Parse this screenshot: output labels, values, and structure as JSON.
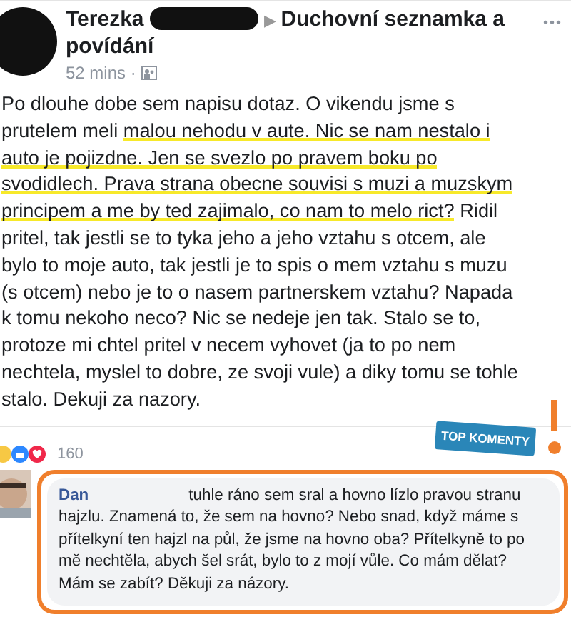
{
  "post": {
    "author": "Terezka",
    "separator": "▶",
    "group_lines": [
      "Duchovní seznamka a",
      "povídání"
    ],
    "time": "52 mins ·",
    "more": "•••",
    "body": [
      [
        {
          "text": "Po dlouhe dobe sem napisu dotaz. O vikendu jsme s",
          "highlighted": false
        }
      ],
      [
        {
          "text": "prutelem meli ",
          "highlighted": false
        },
        {
          "text": "malou nehodu v aute. Nic se nam nestalo i",
          "highlighted": true
        }
      ],
      [
        {
          "text": "auto je pojizdne. Jen se svezlo po pravem boku po",
          "highlighted": true
        }
      ],
      [
        {
          "text": "svodidlech. Prava strana obecne souvisi s muzi a muzskym",
          "highlighted": true
        }
      ],
      [
        {
          "text": "principem a me by ted zajimalo, co nam to melo rict?",
          "highlighted": true
        },
        {
          "text": " Ridil",
          "highlighted": false
        }
      ],
      [
        {
          "text": "pritel, tak jestli se to tyka jeho a jeho vztahu s otcem, ale",
          "highlighted": false
        }
      ],
      [
        {
          "text": "bylo to moje auto, tak jestli je to spis o mem vztahu s muzu",
          "highlighted": false
        }
      ],
      [
        {
          "text": "(s otcem) nebo je to o nasem partnerskem vztahu? Napada",
          "highlighted": false
        }
      ],
      [
        {
          "text": "k tomu nekoho neco? Nic se nedeje jen tak. Stalo se to,",
          "highlighted": false
        }
      ],
      [
        {
          "text": "protoze mi chtel pritel v necem vyhovet (ja to po nem",
          "highlighted": false
        }
      ],
      [
        {
          "text": "nechtela, myslel to dobre, ze svoji vule) a diky tomu se tohle",
          "highlighted": false
        }
      ],
      [
        {
          "text": "stalo. Dekuji za nazory.",
          "highlighted": false
        }
      ]
    ],
    "reactions_count": "160"
  },
  "badge": {
    "label": "TOP KOMENTY"
  },
  "comment": {
    "author": "Dan",
    "lines": [
      "tuhle ráno sem sral a hovno lízlo pravou stranu",
      "hajzlu. Znamená to, že sem na hovno? Nebo snad, když máme s",
      "přítelkyní ten hajzl na půl, že jsme na hovno oba? Přítelkyně to po",
      "mě nechtěla, abych šel srát, bylo to z mojí vůle. Co mám dělat?",
      "Mám se zabít? Děkuji za názory."
    ]
  }
}
